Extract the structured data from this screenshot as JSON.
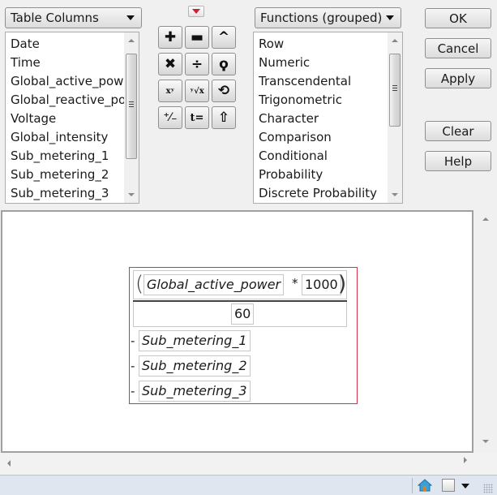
{
  "columns_panel": {
    "selector_label": "Table Columns",
    "items": [
      "Date",
      "Time",
      "Global_active_power",
      "Global_reactive_power",
      "Voltage",
      "Global_intensity",
      "Sub_metering_1",
      "Sub_metering_2",
      "Sub_metering_3"
    ]
  },
  "operators": {
    "menu_icon": "red-triangle-menu-icon",
    "buttons": [
      {
        "name": "add",
        "glyph": "✚"
      },
      {
        "name": "subtract",
        "glyph": "▬"
      },
      {
        "name": "raise-power-caret",
        "glyph": "^"
      },
      {
        "name": "multiply",
        "glyph": "✖"
      },
      {
        "name": "divide",
        "glyph": "÷"
      },
      {
        "name": "local-variable",
        "glyph": "ϙ"
      },
      {
        "name": "power-xy",
        "glyph": "xʸ"
      },
      {
        "name": "root",
        "glyph": "ʸ√x"
      },
      {
        "name": "swap",
        "glyph": "⟲"
      },
      {
        "name": "change-sign",
        "glyph": "⁺⁄₋"
      },
      {
        "name": "assign",
        "glyph": "t="
      },
      {
        "name": "peel",
        "glyph": "⇧"
      }
    ]
  },
  "functions_panel": {
    "selector_label": "Functions (grouped)",
    "items": [
      "Row",
      "Numeric",
      "Transcendental",
      "Trigonometric",
      "Character",
      "Comparison",
      "Conditional",
      "Probability",
      "Discrete Probability"
    ]
  },
  "dialog_buttons": {
    "ok": "OK",
    "cancel": "Cancel",
    "apply": "Apply",
    "clear": "Clear",
    "help": "Help"
  },
  "formula": {
    "numerator_column": "Global_active_power",
    "numerator_operator": "*",
    "numerator_constant": "1000",
    "denominator": "60",
    "minus_sign": "-",
    "subtracted_terms": [
      "Sub_metering_1",
      "Sub_metering_2",
      "Sub_metering_3"
    ],
    "highlight_color": "#d9334a"
  },
  "statusbar": {
    "icons": [
      "home-icon",
      "checkbox-icon",
      "dropdown-arrow-icon",
      "resize-grip-icon"
    ]
  }
}
